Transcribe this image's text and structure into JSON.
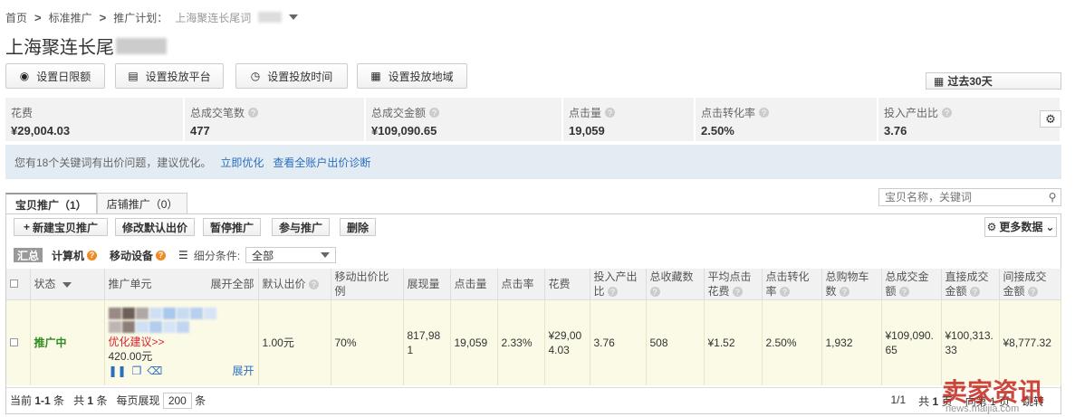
{
  "breadcrumb": {
    "home": "首页",
    "standard": "标准推广",
    "plan_label": "推广计划：",
    "plan_name": "上海聚连长尾词"
  },
  "page_title": "上海聚连长尾",
  "toolbar": {
    "daily_limit": "设置日限额",
    "platform": "设置投放平台",
    "time": "设置投放时间",
    "region": "设置投放地域",
    "range": "过去30天"
  },
  "stats": [
    {
      "label": "花费",
      "value": "¥29,004.03"
    },
    {
      "label": "总成交笔数",
      "value": "477"
    },
    {
      "label": "总成交金额",
      "value": "¥109,090.65"
    },
    {
      "label": "点击量",
      "value": "19,059"
    },
    {
      "label": "点击转化率",
      "value": "2.50%"
    },
    {
      "label": "投入产出比",
      "value": "3.76"
    }
  ],
  "notice": {
    "text": "您有18个关键词有出价问题，建议优化。",
    "link1": "立即优化",
    "link2": "查看全账户出价诊断"
  },
  "tabs": [
    {
      "label": "宝贝推广（1）"
    },
    {
      "label": "店铺推广（0）"
    }
  ],
  "search": {
    "placeholder": "宝贝名称，关键词"
  },
  "actions": {
    "new": "新建宝贝推广",
    "edit_bid": "修改默认出价",
    "pause": "暂停推广",
    "join": "参与推广",
    "delete": "删除",
    "more": "更多数据"
  },
  "filters": {
    "summary": "汇总",
    "computer": "计算机",
    "mobile": "移动设备",
    "condition_label": "细分条件:",
    "condition_value": "全部"
  },
  "table": {
    "headers": {
      "status": "状态",
      "unit": "推广单元",
      "expand_all": "展开全部",
      "default_bid": "默认出价",
      "mobile_ratio": "移动出价比例",
      "impressions": "展现量",
      "clicks": "点击量",
      "ctr": "点击率",
      "cost": "花费",
      "roi": "投入产出比",
      "favorites": "总收藏数",
      "avg_cpc": "平均点击花费",
      "cvr": "点击转化率",
      "carts": "总购物车数",
      "total_gmv": "总成交金额",
      "direct_gmv": "直接成交金额",
      "indirect_gmv": "间接成交金额"
    },
    "row": {
      "status": "推广中",
      "unit_suggest": "优化建议>>",
      "unit_limit": "420.00元",
      "unit_expand": "展开",
      "default_bid": "1.00元",
      "mobile_ratio": "70%",
      "impressions": "817,981",
      "clicks": "19,059",
      "ctr": "2.33%",
      "cost": "¥29,004.03",
      "roi": "3.76",
      "favorites": "508",
      "avg_cpc": "¥1.52",
      "cvr": "2.50%",
      "carts": "1,932",
      "total_gmv": "¥109,090.65",
      "direct_gmv": "¥100,313.33",
      "indirect_gmv": "¥8,777.32"
    }
  },
  "footer": {
    "current_label": "当前",
    "current_value": "1-1",
    "current_unit": "条",
    "total_label": "共",
    "total_value": "1",
    "total_unit": "条",
    "per_page_label": "每页展现",
    "per_page": "200",
    "per_page_unit": "条",
    "page_of": "1/1",
    "pages_label": "共",
    "pages_value": "1",
    "pages_unit": "页",
    "goto_label": "向第",
    "goto_value": "1",
    "goto_unit": "页",
    "jump": "跳转"
  },
  "watermark": {
    "main": "卖家资讯",
    "sub": "news.maijia.com"
  }
}
